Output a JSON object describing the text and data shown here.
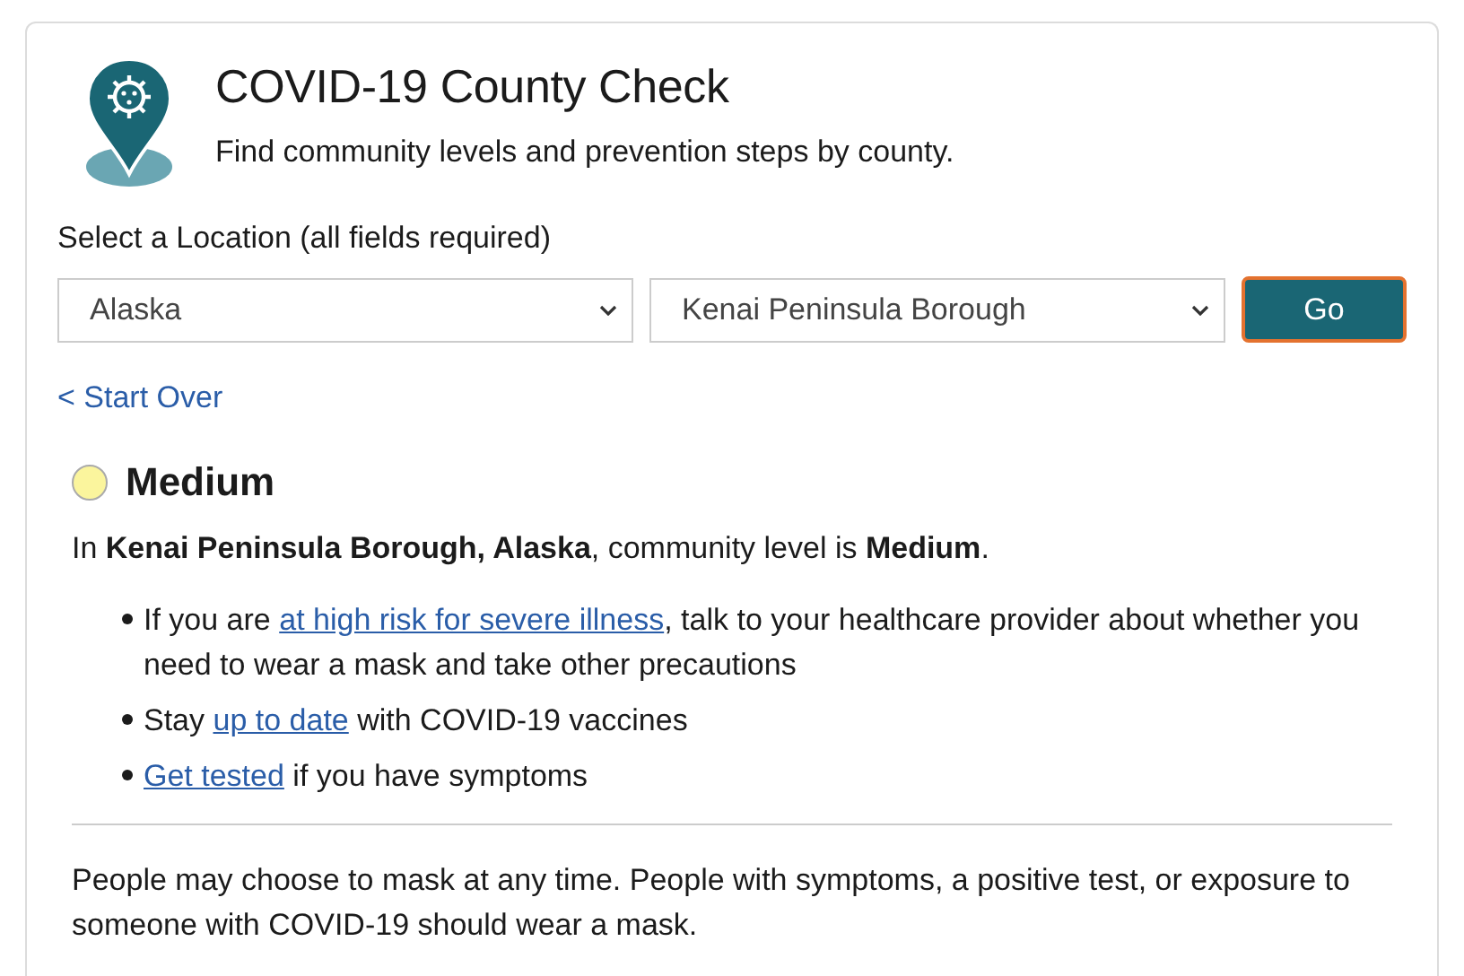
{
  "header": {
    "title": "COVID-19 County Check",
    "subtitle": "Find community levels and prevention steps by county."
  },
  "form": {
    "label": "Select a Location (all fields required)",
    "selects": [
      {
        "value": "Alaska"
      },
      {
        "value": "Kenai Peninsula Borough"
      }
    ],
    "button": "Go"
  },
  "start_over": "< Start Over",
  "result": {
    "level": "Medium",
    "color": "#fbf59d",
    "summary": "In **Kenai Peninsula Borough, Alaska**, community level is **Medium**.",
    "steps": [
      [
        {
          "kind": "text",
          "text": "If you are "
        },
        {
          "kind": "link",
          "text": "at high risk for severe illness"
        },
        {
          "kind": "text",
          "text": ", talk to your healthcare provider about whether you need to wear a mask and take other precautions"
        }
      ],
      [
        {
          "kind": "text",
          "text": "Stay "
        },
        {
          "kind": "link",
          "text": "up to date"
        },
        {
          "kind": "text",
          "text": " with COVID-19 vaccines"
        }
      ],
      [
        {
          "kind": "link",
          "text": "Get tested"
        },
        {
          "kind": "text",
          "text": " if you have symptoms"
        }
      ]
    ],
    "note": "People may choose to mask at any time. People with symptoms, a positive test, or exposure to someone with COVID-19 should wear a mask."
  }
}
